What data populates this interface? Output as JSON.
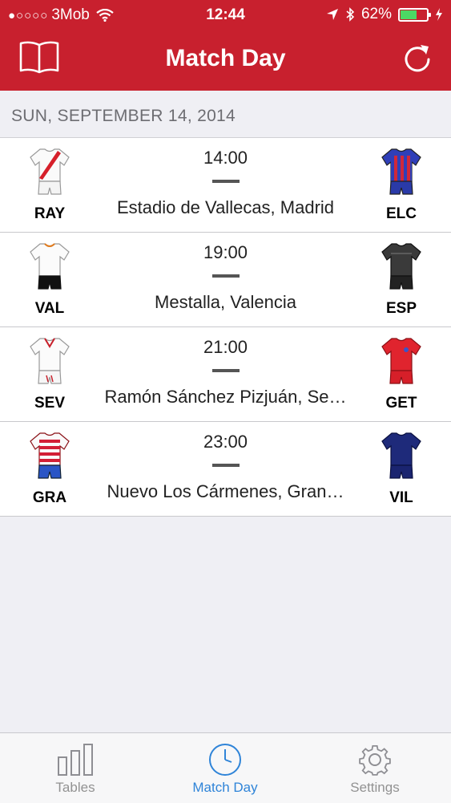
{
  "status_bar": {
    "signal": "●○○○○",
    "carrier": "3Mob",
    "time": "12:44",
    "battery": "62%",
    "battery_level": 0.62
  },
  "header": {
    "title": "Match Day",
    "left_icon": "book-icon",
    "right_icon": "refresh-icon"
  },
  "section": {
    "date": "SUN, SEPTEMBER 14, 2014"
  },
  "matches": [
    {
      "home": "RAY",
      "away": "ELC",
      "time": "14:00",
      "venue": "Estadio de Vallecas, Madrid"
    },
    {
      "home": "VAL",
      "away": "ESP",
      "time": "19:00",
      "venue": "Mestalla, Valencia"
    },
    {
      "home": "SEV",
      "away": "GET",
      "time": "21:00",
      "venue": "Ramón Sánchez Pizjuán, Se…"
    },
    {
      "home": "GRA",
      "away": "VIL",
      "time": "23:00",
      "venue": "Nuevo Los Cármenes, Gran…"
    }
  ],
  "tabbar": {
    "tabs": [
      {
        "label": "Tables",
        "icon": "bar-chart-icon"
      },
      {
        "label": "Match Day",
        "icon": "clock-icon"
      },
      {
        "label": "Settings",
        "icon": "gear-icon"
      }
    ],
    "active_color": "#2f84d8"
  },
  "colors": {
    "brand": "#c8202e",
    "background": "#efeff4"
  }
}
